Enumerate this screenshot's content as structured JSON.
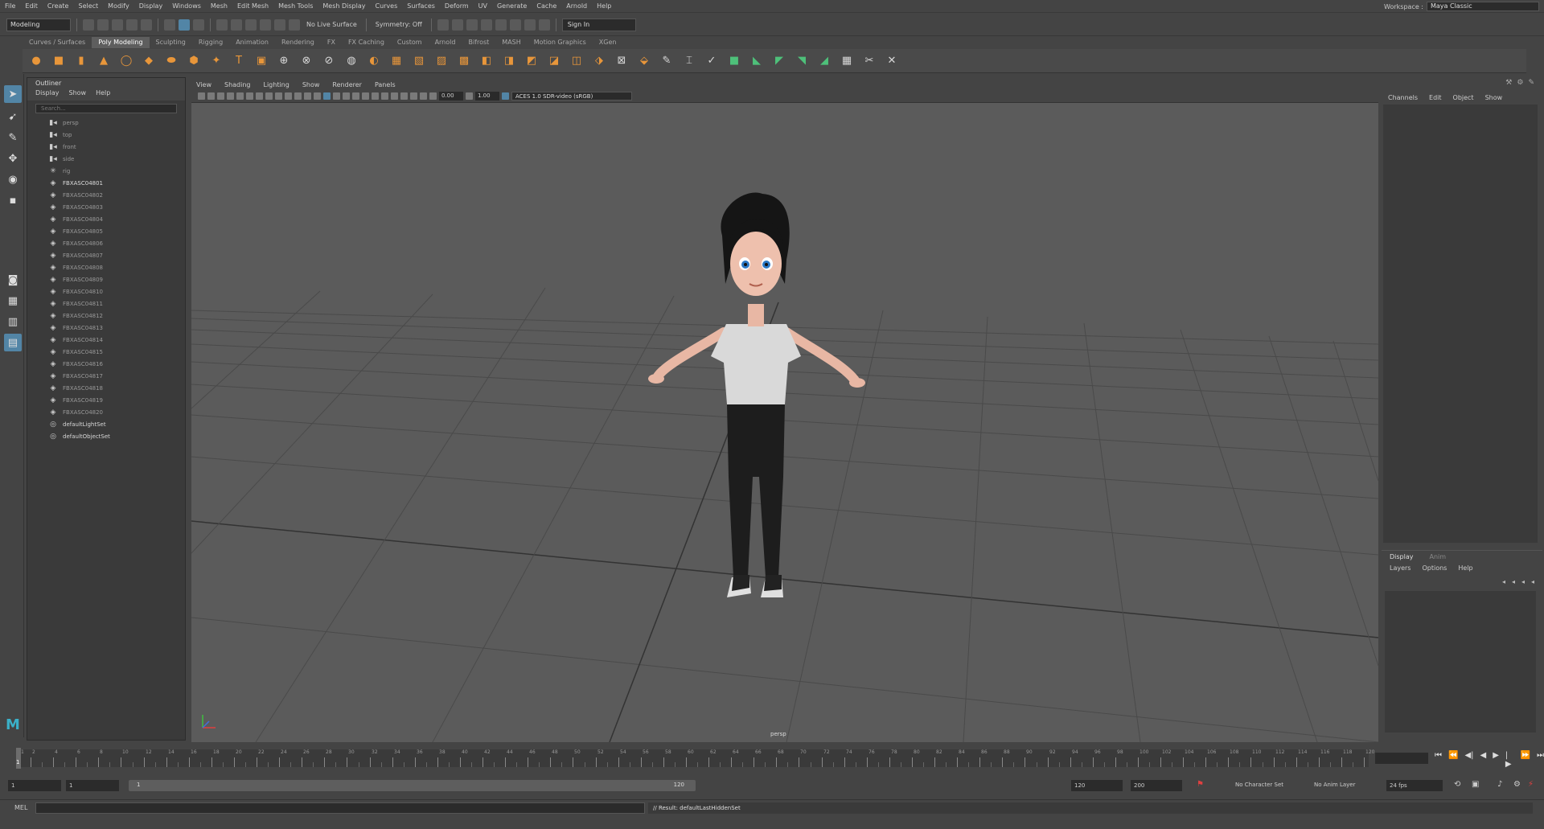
{
  "menubar": {
    "items": [
      "File",
      "Edit",
      "Create",
      "Select",
      "Modify",
      "Display",
      "Windows",
      "Mesh",
      "Edit Mesh",
      "Mesh Tools",
      "Mesh Display",
      "Curves",
      "Surfaces",
      "Deform",
      "UV",
      "Generate",
      "Cache",
      "Arnold",
      "Help"
    ],
    "workspace_label": "Workspace :",
    "workspace_value": "Maya Classic"
  },
  "statusline": {
    "mode": "Modeling",
    "live_surface": "No Live Surface",
    "symmetry": "Symmetry: Off",
    "sign_in": "Sign In"
  },
  "shelf": {
    "tabs": [
      "Curves / Surfaces",
      "Poly Modeling",
      "Sculpting",
      "Rigging",
      "Animation",
      "Rendering",
      "FX",
      "FX Caching",
      "Custom",
      "Arnold",
      "Bifrost",
      "MASH",
      "Motion Graphics",
      "XGen"
    ],
    "active_tab": "Poly Modeling"
  },
  "outliner": {
    "title": "Outliner",
    "menu": [
      "Display",
      "Show",
      "Help"
    ],
    "search_placeholder": "Search...",
    "items": [
      {
        "label": "persp",
        "icon": "camera-icon"
      },
      {
        "label": "top",
        "icon": "camera-icon"
      },
      {
        "label": "front",
        "icon": "camera-icon"
      },
      {
        "label": "side",
        "icon": "camera-icon"
      },
      {
        "label": "rig",
        "icon": "joint-icon"
      },
      {
        "label": "FBXASC04801",
        "icon": "mesh-icon"
      },
      {
        "label": "FBXASC04802",
        "icon": "mesh-icon"
      },
      {
        "label": "FBXASC04803",
        "icon": "mesh-icon"
      },
      {
        "label": "FBXASC04804",
        "icon": "mesh-icon"
      },
      {
        "label": "FBXASC04805",
        "icon": "mesh-icon"
      },
      {
        "label": "FBXASC04806",
        "icon": "mesh-icon"
      },
      {
        "label": "FBXASC04807",
        "icon": "mesh-icon"
      },
      {
        "label": "FBXASC04808",
        "icon": "mesh-icon"
      },
      {
        "label": "FBXASC04809",
        "icon": "mesh-icon"
      },
      {
        "label": "FBXASC04810",
        "icon": "mesh-icon"
      },
      {
        "label": "FBXASC04811",
        "icon": "mesh-icon"
      },
      {
        "label": "FBXASC04812",
        "icon": "mesh-icon"
      },
      {
        "label": "FBXASC04813",
        "icon": "mesh-icon"
      },
      {
        "label": "FBXASC04814",
        "icon": "mesh-icon"
      },
      {
        "label": "FBXASC04815",
        "icon": "mesh-icon"
      },
      {
        "label": "FBXASC04816",
        "icon": "mesh-icon"
      },
      {
        "label": "FBXASC04817",
        "icon": "mesh-icon"
      },
      {
        "label": "FBXASC04818",
        "icon": "mesh-icon"
      },
      {
        "label": "FBXASC04819",
        "icon": "mesh-icon"
      },
      {
        "label": "FBXASC04820",
        "icon": "mesh-icon"
      },
      {
        "label": "defaultLightSet",
        "icon": "set-icon"
      },
      {
        "label": "defaultObjectSet",
        "icon": "set-icon"
      }
    ]
  },
  "viewport": {
    "menu": [
      "View",
      "Shading",
      "Lighting",
      "Show",
      "Renderer",
      "Panels"
    ],
    "exposure": "0.00",
    "gamma": "1.00",
    "color_space": "ACES 1.0 SDR-video (sRGB)",
    "camera": "persp"
  },
  "channelbox": {
    "menu": [
      "Channels",
      "Edit",
      "Object",
      "Show"
    ]
  },
  "layers": {
    "tabs": [
      "Display",
      "Anim"
    ],
    "menu": [
      "Layers",
      "Options",
      "Help"
    ]
  },
  "timeslider": {
    "tick_labels": [
      "1",
      "2",
      "4",
      "6",
      "8",
      "10",
      "12",
      "14",
      "16",
      "18",
      "20",
      "22",
      "24",
      "26",
      "28",
      "30",
      "32",
      "34",
      "36",
      "38",
      "40",
      "42",
      "44",
      "46",
      "48",
      "50",
      "52",
      "54",
      "56",
      "58",
      "60",
      "62",
      "64",
      "66",
      "68",
      "70",
      "72",
      "74",
      "76",
      "78",
      "80",
      "82",
      "84",
      "86",
      "88",
      "90",
      "92",
      "94",
      "96",
      "98",
      "100",
      "102",
      "104",
      "106",
      "108",
      "110",
      "112",
      "114",
      "116",
      "118",
      "120"
    ],
    "current_frame": "1"
  },
  "rangeslider": {
    "start": "1",
    "playback_start": "1",
    "range_start": "1",
    "range_end": "120",
    "playback_end": "120",
    "end": "200",
    "character_set": "No Character Set",
    "anim_layer": "No Anim Layer",
    "fps": "24 fps"
  },
  "cmdline": {
    "label": "MEL",
    "result": "// Result: defaultLastHiddenSet"
  },
  "colors": {
    "accent": "#5285a6",
    "shelf_orange": "#e8963a",
    "viewport_bg": "#5b5b5b"
  }
}
